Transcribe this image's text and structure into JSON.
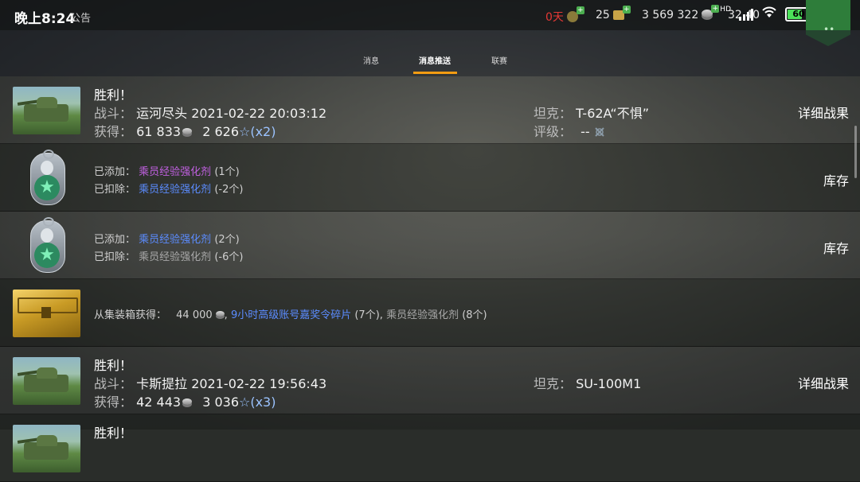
{
  "status_bar": {
    "time": "晚上8:24",
    "notice": "公告",
    "days": "0天",
    "gold": "25",
    "credits": "3 569 322",
    "free_xp": "32 40",
    "net_label": "HD",
    "battery": "60"
  },
  "tabs": [
    {
      "label": "消息"
    },
    {
      "label": "消息推送"
    },
    {
      "label": "联赛"
    }
  ],
  "rows": [
    {
      "title": "胜利！",
      "battle_label": "战斗：",
      "battle_value": "运河尽头 2021-02-22 20:03:12",
      "gain_label": "获得：",
      "credits": "61 833",
      "xp": "2 626",
      "multiplier": "(x2)",
      "tank_label": "坦克：",
      "tank_value": "T-62A“不惧”",
      "rating_label": "评级：",
      "rating_value": "--",
      "action": "详细战果"
    },
    {
      "added_label": "已添加：",
      "added_item": "乘员经验强化剂",
      "added_count": "(1个)",
      "removed_label": "已扣除：",
      "removed_item": "乘员经验强化剂",
      "removed_count": "(-2个)",
      "action": "库存"
    },
    {
      "added_label": "已添加：",
      "added_item": "乘员经验强化剂",
      "added_count": "(2个)",
      "removed_label": "已扣除：",
      "removed_item": "乘员经验强化剂",
      "removed_count": "(-6个)",
      "action": "库存"
    },
    {
      "label": "从集装箱获得：",
      "credits": "44 000",
      "sep1": ",",
      "item1": "9小时高级账号嘉奖令碎片",
      "item1_count": "(7个)",
      "sep2": ",",
      "item2": "乘员经验强化剂",
      "item2_count": "(8个)"
    },
    {
      "title": "胜利！",
      "battle_label": "战斗：",
      "battle_value": "卡斯提拉 2021-02-22 19:56:43",
      "gain_label": "获得：",
      "credits": "42 443",
      "xp": "3 036",
      "multiplier": "(x3)",
      "tank_label": "坦克：",
      "tank_value": "SU-100M1",
      "action": "详细战果"
    },
    {
      "title": "胜利！"
    }
  ]
}
